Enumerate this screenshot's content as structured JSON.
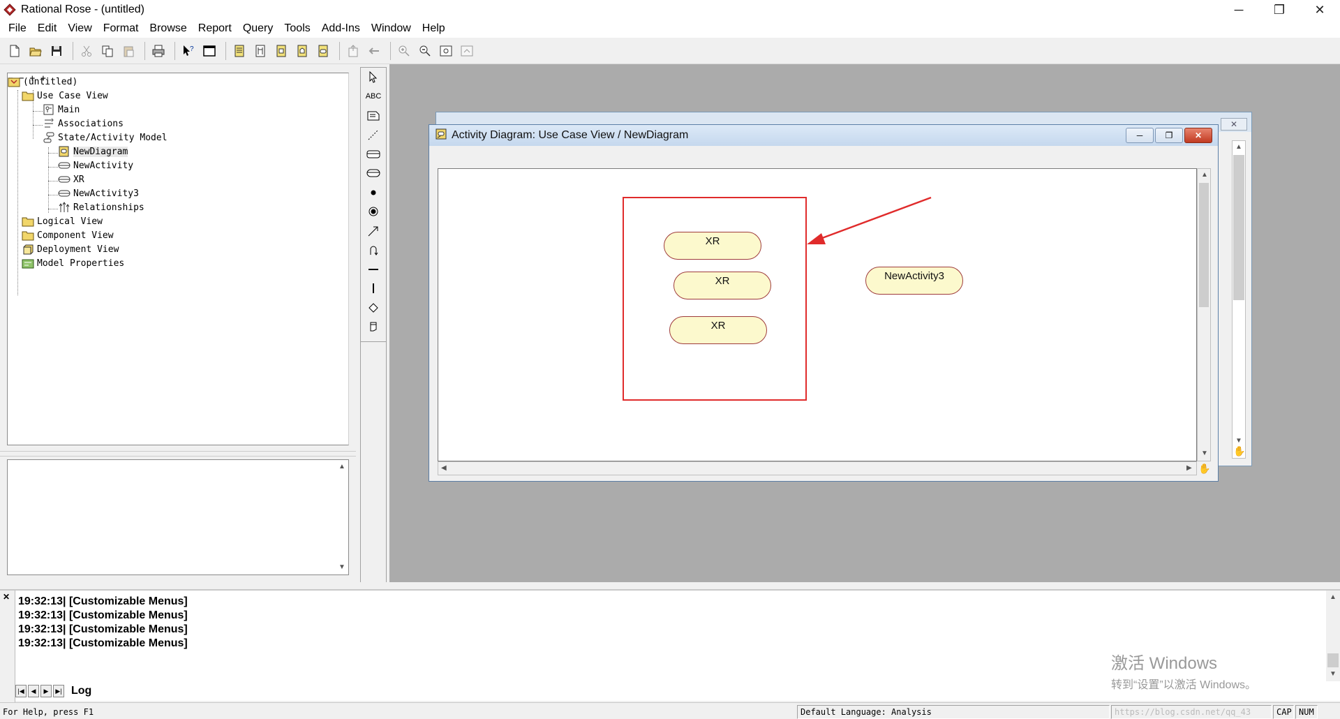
{
  "window": {
    "title": "Rational Rose - (untitled)",
    "minimize_glyph": "─",
    "restore_glyph": "❐",
    "close_glyph": "✕"
  },
  "menu": [
    "File",
    "Edit",
    "View",
    "Format",
    "Browse",
    "Report",
    "Query",
    "Tools",
    "Add-Ins",
    "Window",
    "Help"
  ],
  "toolbar_icons": [
    "new-icon",
    "open-icon",
    "save-icon",
    "cut-icon",
    "copy-icon",
    "paste-icon",
    "print-icon",
    "context-help-icon",
    "view-doc-icon",
    "class-diagram-icon",
    "interaction-diagram-icon",
    "component-diagram-icon",
    "deployment-diagram-icon",
    "statechart-diagram-icon",
    "browse-parent-icon",
    "previous-diagram-icon",
    "zoom-in-icon",
    "zoom-out-icon",
    "fit-in-window-icon",
    "undo-fit-icon"
  ],
  "browser": {
    "items": [
      {
        "label": "(untitled)",
        "icon": "model-icon"
      },
      {
        "label": "Use Case View",
        "icon": "folder-icon"
      },
      {
        "label": "Main",
        "icon": "diagram-icon"
      },
      {
        "label": "Associations",
        "icon": "associations-icon"
      },
      {
        "label": "State/Activity Model",
        "icon": "state-model-icon"
      },
      {
        "label": "NewDiagram",
        "icon": "activity-diagram-icon"
      },
      {
        "label": "NewActivity",
        "icon": "activity-icon"
      },
      {
        "label": "XR",
        "icon": "activity-icon"
      },
      {
        "label": "NewActivity3",
        "icon": "activity-icon"
      },
      {
        "label": "Relationships",
        "icon": "relationships-icon"
      },
      {
        "label": "Logical View",
        "icon": "folder-icon"
      },
      {
        "label": "Component View",
        "icon": "folder-icon"
      },
      {
        "label": "Deployment View",
        "icon": "deployment-icon"
      },
      {
        "label": "Model Properties",
        "icon": "properties-icon"
      }
    ],
    "selected": "NewDiagram"
  },
  "toolbox": [
    "selection-arrow-icon",
    "text-box-icon",
    "note-icon",
    "anchor-note-icon",
    "state-icon",
    "activity-tool-icon",
    "start-state-icon",
    "end-state-icon",
    "state-transition-icon",
    "transition-to-self-icon",
    "horizontal-sync-icon",
    "vertical-sync-icon",
    "decision-icon",
    "swimlane-icon"
  ],
  "toolbox_text_tool": "ABC",
  "diagram_window": {
    "title": "Activity Diagram: Use Case View / NewDiagram",
    "activities": [
      "XR",
      "XR",
      "XR",
      "NewActivity3"
    ]
  },
  "log": {
    "lines": [
      "19:32:13|  [Customizable Menus]",
      "19:32:13|  [Customizable Menus]",
      "19:32:13|  [Customizable Menus]",
      "19:32:13|  [Customizable Menus]"
    ],
    "tab": "Log"
  },
  "watermark": {
    "line1": "激活 Windows",
    "line2": "转到“设置”以激活 Windows。"
  },
  "status": {
    "help": "For Help, press F1",
    "language": "Default Language: Analysis",
    "url": "https://blog.csdn.net/qq_43",
    "cap": "CAP",
    "num": "NUM"
  },
  "colors": {
    "activity_fill": "#fcf9cd",
    "activity_border": "#9e3b3b",
    "annotation_red": "#e02b2b",
    "mdi_background": "#ababab"
  }
}
